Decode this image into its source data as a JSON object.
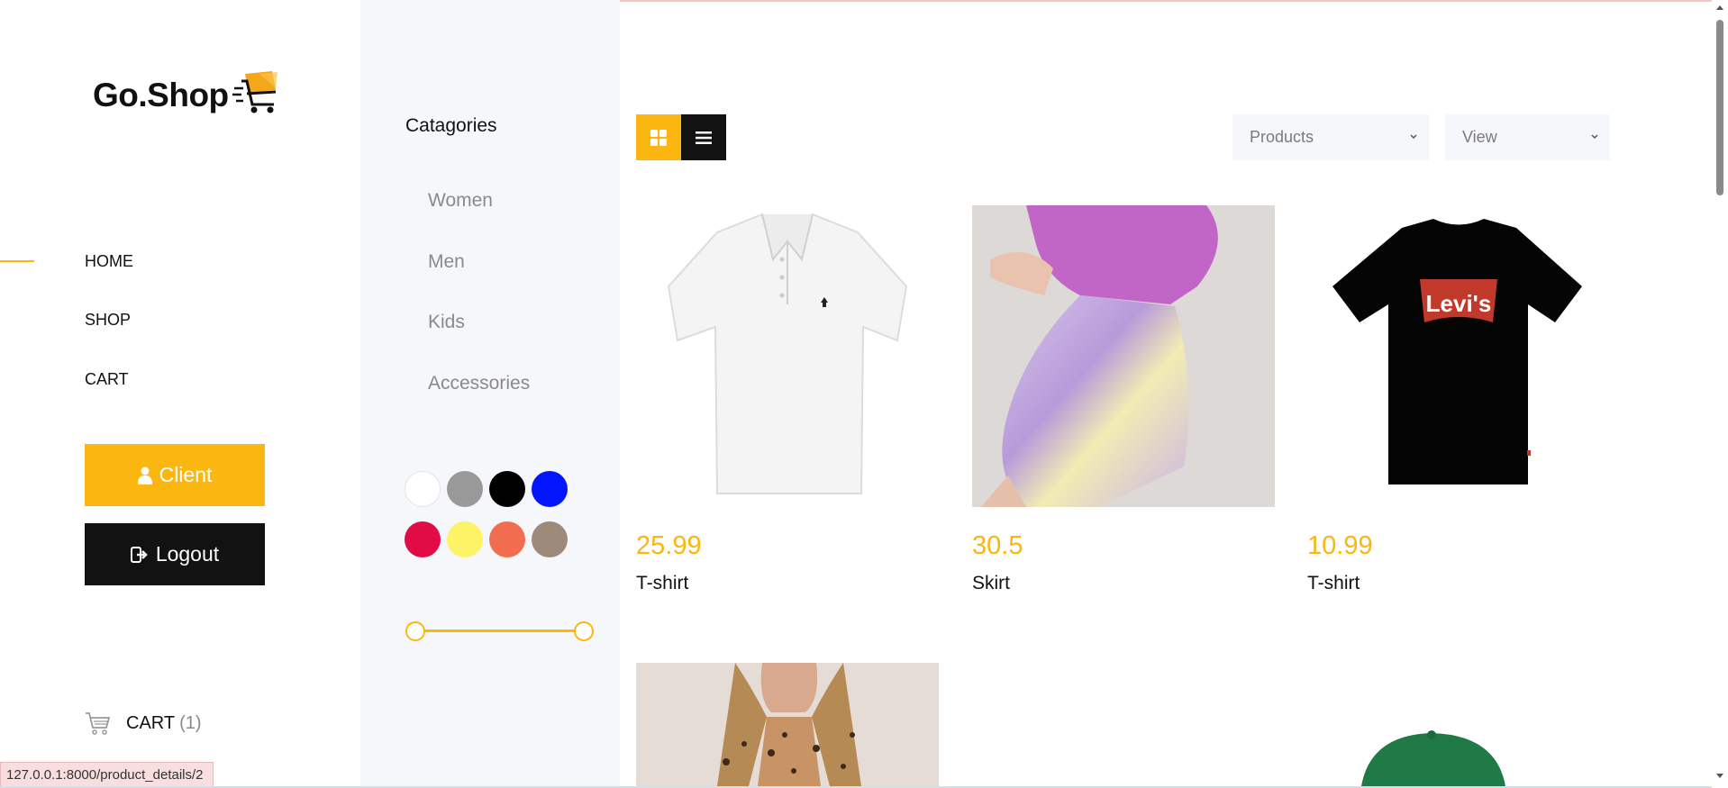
{
  "brand": {
    "name": "Go.Shop",
    "accent": "#fbb710",
    "dark": "#131212"
  },
  "nav": {
    "items": [
      {
        "label": "HOME",
        "active": true
      },
      {
        "label": "SHOP"
      },
      {
        "label": "CART"
      }
    ],
    "client_label": "Client",
    "logout_label": "Logout",
    "cart_label": "CART",
    "cart_count": "(1)"
  },
  "filters": {
    "title": "Catagories",
    "categories": [
      "Women",
      "Men",
      "Kids",
      "Accessories"
    ],
    "colors": [
      "#ffffff",
      "#999999",
      "#000000",
      "#0315ff",
      "#e10b45",
      "#fdf367",
      "#f26c4f",
      "#9d8a7a"
    ],
    "price_range": {
      "min_fraction": 0,
      "max_fraction": 1
    }
  },
  "toolbar": {
    "grid_icon": "grid-icon",
    "list_icon": "list-icon",
    "sort_select": "Products",
    "view_select": "View"
  },
  "products": [
    {
      "price": "25.99",
      "name": "T-shirt",
      "image": "white-polo-shirt"
    },
    {
      "price": "30.5",
      "name": "Skirt",
      "image": "tie-dye-skirt"
    },
    {
      "price": "10.99",
      "name": "T-shirt",
      "image": "black-levis-tshirt"
    }
  ],
  "products_row2": [
    {
      "image": "leopard-print-blouse"
    },
    {
      "image": "green-cap"
    }
  ],
  "status_bar": {
    "url": "127.0.0.1:8000/product_details/2"
  }
}
